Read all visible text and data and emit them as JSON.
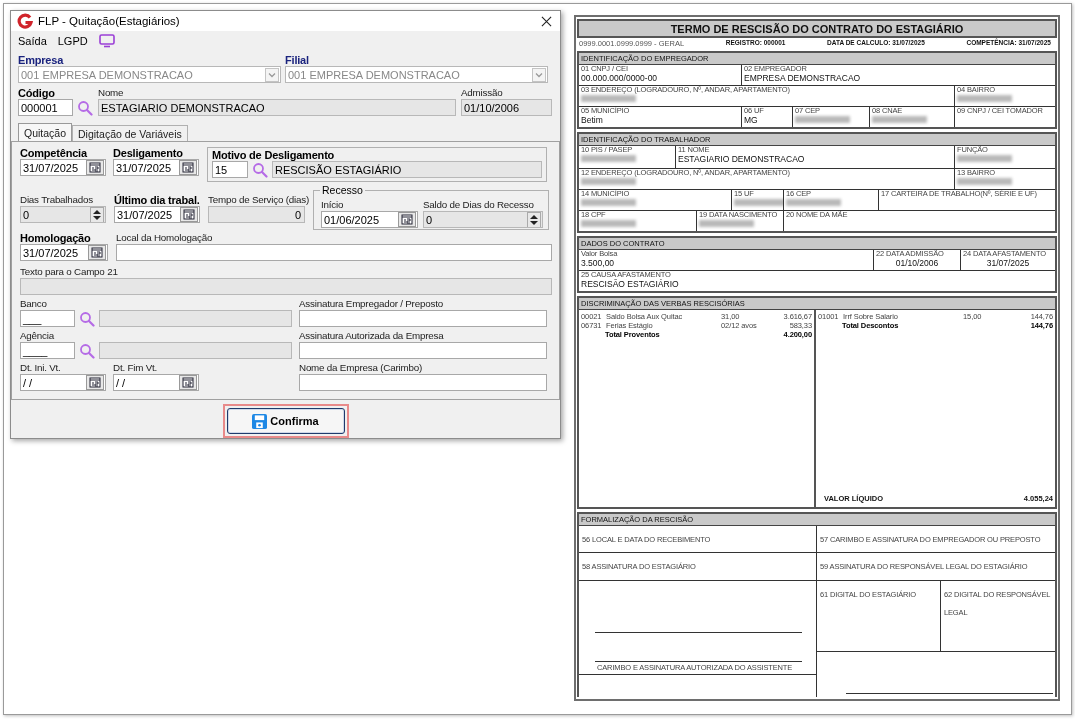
{
  "dialog": {
    "title": "FLP - Quitação(Estagiários)",
    "menu": [
      "Saída",
      "LGPD"
    ],
    "company": [
      {
        "label": "Empresa",
        "kind": "combo",
        "value": "001 EMPRESA DEMONSTRACAO",
        "required": true,
        "disabled": true
      },
      {
        "label": "Filial",
        "kind": "combo",
        "value": "001 EMPRESA DEMONSTRACAO",
        "required": true,
        "disabled": true
      }
    ],
    "employee": [
      {
        "label": "Código",
        "kind": "lookup",
        "value": "000001",
        "required": true,
        "disabled": false
      },
      {
        "label": "Nome",
        "kind": "text",
        "value": "ESTAGIARIO DEMONSTRACAO",
        "required": false,
        "disabled": true
      },
      {
        "label": "Admissão",
        "kind": "text",
        "value": "01/10/2006",
        "required": false,
        "disabled": true
      }
    ],
    "tabs": [
      {
        "label": "Quitação",
        "selected": true
      },
      {
        "label": "Digitação de Variáveis",
        "selected": false
      }
    ],
    "dates": [
      {
        "label": "Competência",
        "kind": "date",
        "value": "31/07/2025",
        "required": true,
        "disabled": false
      },
      {
        "label": "Desligamento",
        "kind": "date",
        "value": "31/07/2025",
        "required": true,
        "disabled": false
      }
    ],
    "motivo": {
      "title": "Motivo de Desligamento",
      "code": "15",
      "description": "RESCISÃO ESTAGIÁRIO"
    },
    "work": [
      {
        "label": "Dias Trabalhados",
        "kind": "spin",
        "value": "0",
        "required": false,
        "disabled": true
      },
      {
        "label": "Último dia trabal.",
        "kind": "date",
        "value": "31/07/2025",
        "required": true,
        "disabled": false
      },
      {
        "label": "Tempo de Serviço (dias)",
        "kind": "number",
        "value": "0",
        "required": false,
        "disabled": true
      }
    ],
    "recesso": {
      "title": "Recesso",
      "fields": [
        {
          "label": "Início",
          "kind": "date",
          "value": "01/06/2025",
          "required": false,
          "disabled": false
        },
        {
          "label": "Saldo de Dias do Recesso",
          "kind": "spin",
          "value": "0",
          "required": false,
          "disabled": true
        }
      ]
    },
    "homologacao": [
      {
        "label": "Homologação",
        "kind": "date",
        "value": "31/07/2025",
        "required": true,
        "disabled": false
      },
      {
        "label": "Local da Homologação",
        "kind": "text",
        "required": false,
        "disabled": false
      }
    ],
    "texto21": {
      "label": "Texto para o Campo 21",
      "kind": "text",
      "required": false,
      "disabled": true
    },
    "bank": [
      {
        "label": "Banco",
        "kind": "lookup-named",
        "value": "___",
        "required": false,
        "disabled": false
      },
      {
        "label": "Agência",
        "kind": "lookup-named",
        "value": "____",
        "required": false,
        "disabled": false
      }
    ],
    "vt": [
      {
        "label": "Dt. Ini. Vt.",
        "kind": "date",
        "value": "/ /",
        "required": false,
        "disabled": false
      },
      {
        "label": "Dt. Fim Vt.",
        "kind": "date",
        "value": "/ /",
        "required": false,
        "disabled": false
      }
    ],
    "signatures": [
      {
        "label": "Assinatura Empregador / Preposto",
        "kind": "text",
        "required": false,
        "disabled": false
      },
      {
        "label": "Assinatura Autorizada da Empresa",
        "kind": "text",
        "required": false,
        "disabled": false
      },
      {
        "label": "Nome da Empresa (Carimbo)",
        "kind": "text",
        "required": false,
        "disabled": false
      }
    ],
    "confirm": {
      "label": "Confirma",
      "highlighted": true
    }
  },
  "report": {
    "title": "TERMO DE RESCISÃO DO CONTRATO DO ESTAGIÁRIO",
    "header": [
      "0999.0001.0999.0999 - GERAL",
      "REGISTRO: 000001",
      "DATA DE CALCULO: 31/07/2025",
      "COMPETÊNCIA: 31/07/2025"
    ],
    "sections": [
      {
        "title": "IDENTIFICAÇÃO DO EMPREGADOR",
        "lines": [
          {
            "fields": [
              {
                "label": "01 CNPJ / CEI",
                "value": "00.000.000/0000-00",
                "redacted": false
              },
              {
                "label": "02 EMPREGADOR",
                "value": "EMPRESA DEMONSTRACAO",
                "redacted": false
              }
            ]
          },
          {
            "fields": [
              {
                "label": "03 ENDEREÇO (LOGRADOURO, Nº, ANDAR, APARTAMENTO)",
                "redacted": true
              },
              {
                "label": "04 BAIRRO",
                "redacted": true
              }
            ]
          },
          {
            "fields": [
              {
                "label": "05 MUNICÍPIO",
                "value": "Betim",
                "redacted": false
              },
              {
                "label": "06 UF",
                "value": "MG",
                "redacted": false
              },
              {
                "label": "07 CEP",
                "redacted": true
              },
              {
                "label": "08 CNAE",
                "redacted": true
              },
              {
                "label": "09 CNPJ / CEI TOMADOR",
                "redacted": false
              }
            ]
          }
        ]
      },
      {
        "title": "IDENTIFICAÇÃO DO TRABALHADOR",
        "lines": [
          {
            "fields": [
              {
                "label": "10 PIS / PASEP",
                "redacted": true
              },
              {
                "label": "11 NOME",
                "value": "ESTAGIARIO DEMONSTRACAO",
                "redacted": false
              },
              {
                "label": "FUNÇÃO",
                "redacted": true
              }
            ]
          },
          {
            "fields": [
              {
                "label": "12 ENDEREÇO (LOGRADOURO, Nº, ANDAR, APARTAMENTO)",
                "redacted": true
              },
              {
                "label": "13 BAIRRO",
                "redacted": true
              }
            ]
          },
          {
            "fields": [
              {
                "label": "14 MUNICÍPIO",
                "redacted": true
              },
              {
                "label": "15 UF",
                "redacted": true
              },
              {
                "label": "16 CEP",
                "redacted": true
              },
              {
                "label": "17 CARTEIRA DE TRABALHO(Nº, SÉRIE E UF)",
                "redacted": false
              }
            ]
          },
          {
            "fields": [
              {
                "label": "18 CPF",
                "redacted": true
              },
              {
                "label": "19 DATA NASCIMENTO",
                "redacted": true
              },
              {
                "label": "20 NOME DA MÃE",
                "redacted": false
              }
            ]
          }
        ]
      },
      {
        "title": "DADOS DO CONTRATO",
        "lines": [
          {
            "fields": [
              {
                "label": "Valor Bolsa",
                "value": "3.500,00",
                "redacted": false
              },
              {
                "label": "22 DATA ADMISSÃO",
                "value": "01/10/2006",
                "redacted": false
              },
              {
                "label": "24 DATA AFASTAMENTO",
                "value": "31/07/2025",
                "redacted": false
              }
            ]
          },
          {
            "fields": [
              {
                "label": "25 CAUSA AFASTAMENTO",
                "value": "RESCISÃO ESTAGIÁRIO",
                "redacted": false
              }
            ]
          }
        ]
      }
    ],
    "verbas": {
      "title": "DISCRIMINAÇÃO DAS VERBAS RESCISÓRIAS",
      "proventos": [
        {
          "code": "00021",
          "description": "Saldo Bolsa Aux Quitac",
          "reference": "31,00",
          "amount": "3.616,67"
        },
        {
          "code": "06731",
          "description": "Ferias Estágio",
          "reference": "02/12 avos",
          "amount": "583,33"
        }
      ],
      "total_proventos": {
        "label": "Total Proventos",
        "amount": "4.200,00"
      },
      "descontos": [
        {
          "code": "01001",
          "description": "Irrf Sobre Salario",
          "reference": "15,00",
          "amount": "144,76"
        }
      ],
      "total_descontos": {
        "label": "Total Descontos",
        "amount": "144,76"
      },
      "liquido": {
        "label": "VALOR LÍQUIDO",
        "amount": "4.055,24"
      }
    },
    "formalizacao": {
      "title": "FORMALIZAÇÃO DA RESCISÃO",
      "cells": [
        "56 LOCAL E DATA DO RECEBIMENTO",
        "57 CARIMBO E ASSINATURA DO EMPREGADOR OU PREPOSTO",
        "58 ASSINATURA DO ESTAGIÁRIO",
        "59 ASSINATURA DO RESPONSÁVEL LEGAL DO ESTAGIÁRIO",
        "61 DIGITAL DO ESTAGIÁRIO",
        "62 DIGITAL DO RESPONSÁVEL LEGAL"
      ],
      "assistant_caption": "CARIMBO E ASSINATURA AUTORIZADA DO ASSISTENTE"
    }
  }
}
